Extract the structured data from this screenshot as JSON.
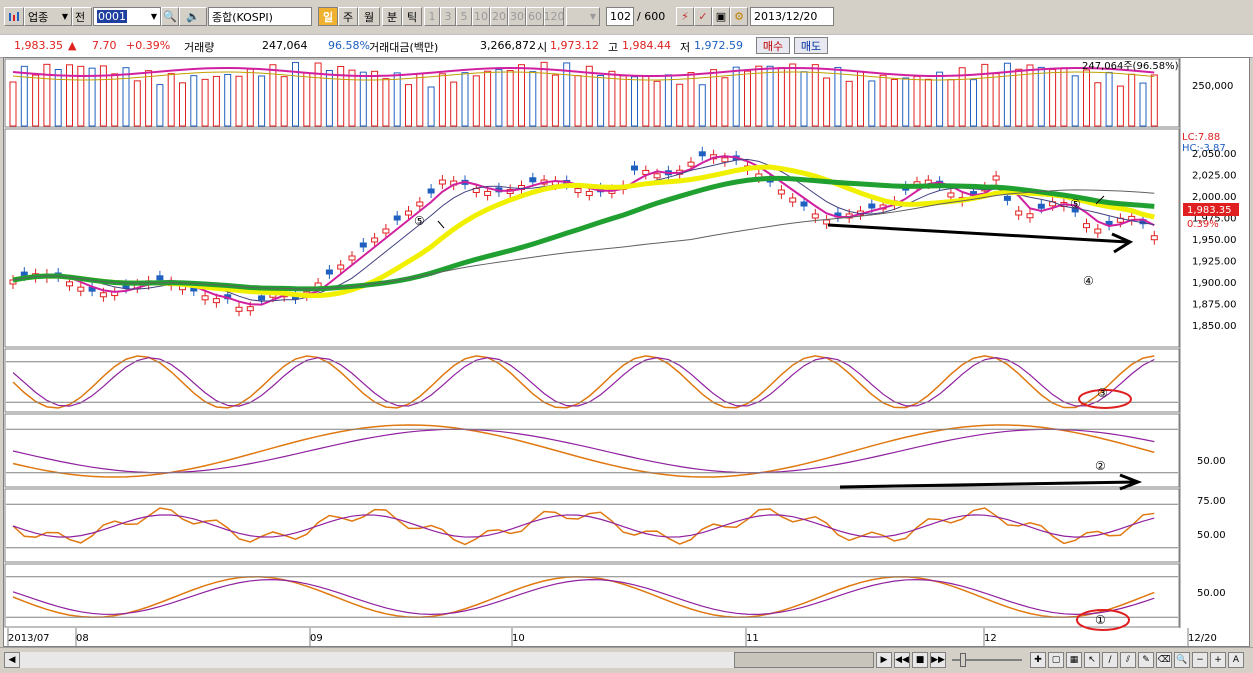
{
  "toolbar": {
    "market_type": "업종",
    "prev_label": "전",
    "code": "0001",
    "index_name": "종합(KOSPI)",
    "period_day": "일",
    "period_week": "주",
    "period_month": "월",
    "period_minute": "분",
    "period_tick": "틱",
    "intervals": [
      "1",
      "3",
      "5",
      "10",
      "20",
      "30",
      "60",
      "120"
    ],
    "count": "102",
    "total": "/ 600",
    "date": "2013/12/20"
  },
  "quote": {
    "price": "1,983.35",
    "change_arrow": "▲",
    "change": "7.70",
    "change_pct": "+0.39%",
    "volume_label": "거래량",
    "volume": "247,064",
    "volume_ratio": "96.58%",
    "amount_label": "거래대금(백만)",
    "amount": "3,266,872",
    "open_label": "시",
    "open": "1,973.12",
    "high_label": "고",
    "high": "1,984.44",
    "low_label": "저",
    "low": "1,972.59",
    "buy_label": "매수",
    "sell_label": "매도"
  },
  "chart": {
    "volume_readout": "247,064주(96.58%)",
    "volume_axis": "250,000",
    "lc_label": "LC:7.88",
    "hc_label": "HC:-3.87",
    "price_ticks": [
      "2,050.00",
      "2,025.00",
      "2,000.00",
      "1,975.00",
      "1,950.00",
      "1,925.00",
      "1,900.00",
      "1,875.00",
      "1,850.00"
    ],
    "price_tag": "1,983.35",
    "price_pct": "0.39%",
    "macd_axis": "50.00",
    "rsi_axis_top": "75.00",
    "rsi_axis_mid": "50.00",
    "lower_axis": "50.00",
    "annotations": [
      "⑤",
      "⑤",
      "④",
      "③",
      "②",
      "①"
    ],
    "date_axis": [
      "2013/07",
      "08",
      "09",
      "10",
      "11",
      "12",
      "12/20"
    ]
  },
  "colors": {
    "up": "#e02020",
    "down": "#2060c0",
    "ma_yellow": "#f0f000",
    "ma_green": "#20a030",
    "ma_magenta": "#d020a0",
    "osc_orange": "#e07810",
    "osc_purple": "#9020a0"
  }
}
